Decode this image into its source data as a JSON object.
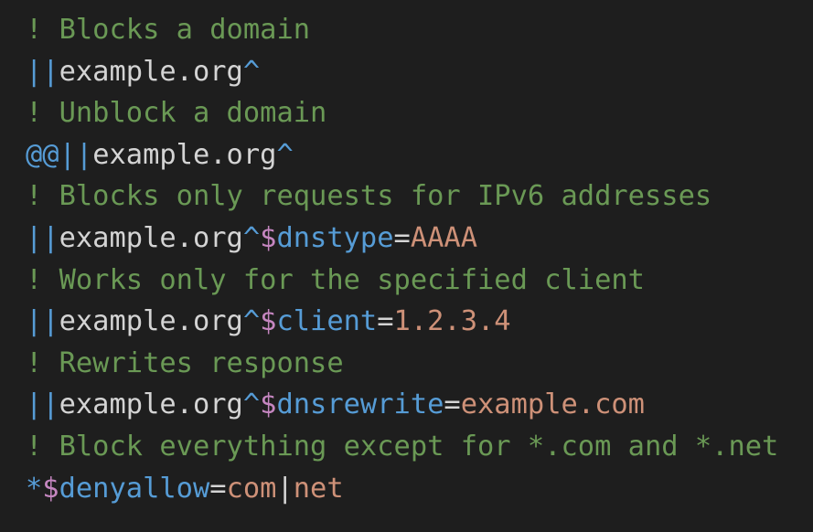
{
  "editor": {
    "theme_colors": {
      "background": "#1e1e1e",
      "comment": "#6a9955",
      "operator": "#569cd6",
      "text": "#d4d4d4",
      "modifier_prefix": "#c586c0",
      "value": "#ce9178"
    },
    "lines": [
      {
        "type": "comment",
        "tokens": [
          {
            "t": "comment",
            "v": "! Blocks a domain"
          }
        ]
      },
      {
        "type": "rule",
        "tokens": [
          {
            "t": "op",
            "v": "||"
          },
          {
            "t": "text",
            "v": "example.org"
          },
          {
            "t": "op",
            "v": "^"
          }
        ]
      },
      {
        "type": "comment",
        "tokens": [
          {
            "t": "comment",
            "v": "! Unblock a domain"
          }
        ]
      },
      {
        "type": "rule",
        "tokens": [
          {
            "t": "op",
            "v": "@@||"
          },
          {
            "t": "text",
            "v": "example.org"
          },
          {
            "t": "op",
            "v": "^"
          }
        ]
      },
      {
        "type": "comment",
        "tokens": [
          {
            "t": "comment",
            "v": "! Blocks only requests for IPv6 addresses"
          }
        ]
      },
      {
        "type": "rule",
        "tokens": [
          {
            "t": "op",
            "v": "||"
          },
          {
            "t": "text",
            "v": "example.org"
          },
          {
            "t": "op",
            "v": "^"
          },
          {
            "t": "dollar",
            "v": "$"
          },
          {
            "t": "opt",
            "v": "dnstype"
          },
          {
            "t": "eq",
            "v": "="
          },
          {
            "t": "val",
            "v": "AAAA"
          }
        ]
      },
      {
        "type": "comment",
        "tokens": [
          {
            "t": "comment",
            "v": "! Works only for the specified client"
          }
        ]
      },
      {
        "type": "rule",
        "tokens": [
          {
            "t": "op",
            "v": "||"
          },
          {
            "t": "text",
            "v": "example.org"
          },
          {
            "t": "op",
            "v": "^"
          },
          {
            "t": "dollar",
            "v": "$"
          },
          {
            "t": "opt",
            "v": "client"
          },
          {
            "t": "eq",
            "v": "="
          },
          {
            "t": "val",
            "v": "1.2.3.4"
          }
        ]
      },
      {
        "type": "comment",
        "tokens": [
          {
            "t": "comment",
            "v": "! Rewrites response"
          }
        ]
      },
      {
        "type": "rule",
        "tokens": [
          {
            "t": "op",
            "v": "||"
          },
          {
            "t": "text",
            "v": "example.org"
          },
          {
            "t": "op",
            "v": "^"
          },
          {
            "t": "dollar",
            "v": "$"
          },
          {
            "t": "opt",
            "v": "dnsrewrite"
          },
          {
            "t": "eq",
            "v": "="
          },
          {
            "t": "val",
            "v": "example.com"
          }
        ]
      },
      {
        "type": "comment",
        "tokens": [
          {
            "t": "comment",
            "v": "! Block everything except for *.com and *.net"
          }
        ]
      },
      {
        "type": "rule",
        "tokens": [
          {
            "t": "op",
            "v": "*"
          },
          {
            "t": "dollar",
            "v": "$"
          },
          {
            "t": "opt",
            "v": "denyallow"
          },
          {
            "t": "eq",
            "v": "="
          },
          {
            "t": "val",
            "v": "com"
          },
          {
            "t": "text",
            "v": "|"
          },
          {
            "t": "val",
            "v": "net"
          }
        ]
      }
    ]
  }
}
